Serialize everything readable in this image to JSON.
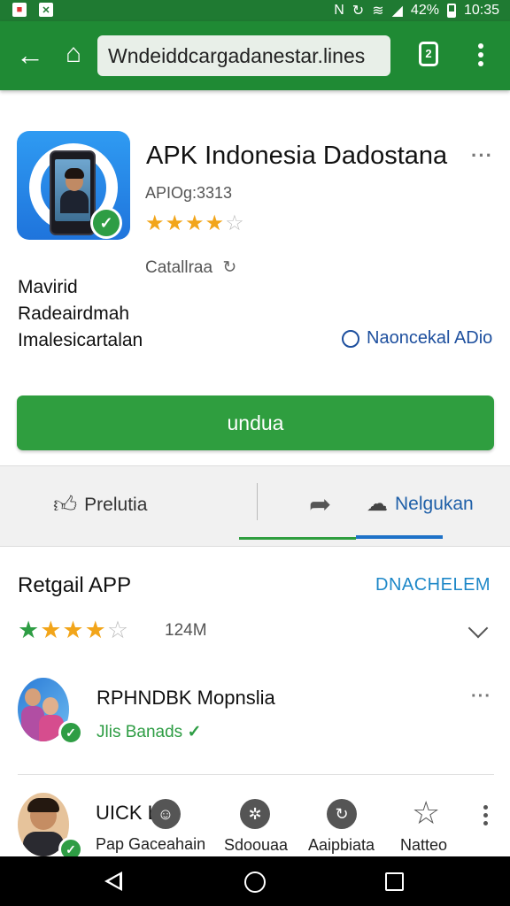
{
  "status_bar": {
    "battery": "42%",
    "time": "10:35"
  },
  "toolbar": {
    "url": "Wndeiddcargadanestar.lines",
    "tabs_count": "2"
  },
  "app": {
    "title": "APK Indonesia Dadostana",
    "version": "APIOg:3313",
    "rating_stars": 4,
    "category": "Catallraa",
    "description": [
      "Mavirid",
      "Radeairdmah",
      "Imalesicartalan"
    ],
    "link_label": "Naoncekal ADio",
    "install_label": "undua"
  },
  "actions": {
    "like_label": "Prelutia",
    "share_label": "Nelgukan"
  },
  "reviews": {
    "title": "Retgail APP",
    "link": "DNACHELEM",
    "rating_stars": 4,
    "count": "124M",
    "items": [
      {
        "name": "RPHNDBK Mopnslia",
        "subtitle": "Jlis Banads"
      },
      {
        "name": "UICK L",
        "subtitle": "Pap Gaceahain"
      }
    ]
  },
  "bottom_actions": [
    "Sdoouaa",
    "Aaipbiata",
    "Natteo"
  ],
  "colors": {
    "primary_green": "#1f8a34",
    "button_green": "#2f9e3f",
    "accent_blue": "#1e72c8",
    "star_gold": "#f2a51a"
  }
}
